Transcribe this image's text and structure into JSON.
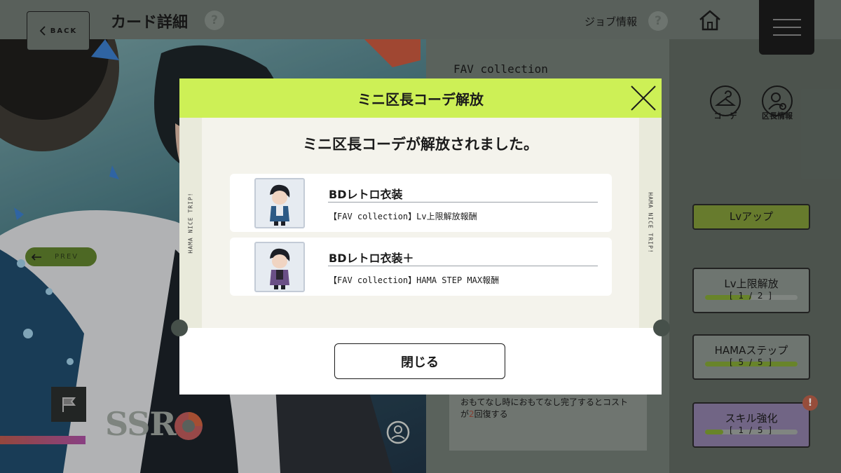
{
  "header": {
    "back_label": "BACK",
    "page_title": "カード詳細",
    "help_glyph": "?",
    "job_info_label": "ジョブ情報",
    "home_icon": "home-icon",
    "menu_icon": "hamburger-icon"
  },
  "card": {
    "collection_title": "FAV collection",
    "rarity": "SSR",
    "prev_label": "PREV",
    "nav_icons": [
      {
        "label": "コーデ",
        "icon": "hanger-icon"
      },
      {
        "label": "区長情報",
        "icon": "user-search-icon"
      }
    ],
    "lvup_label": "Lvアップ",
    "stats": [
      {
        "label": "Lv上限解放",
        "count": "[ 1 / 2 ]",
        "progress": 0.5
      },
      {
        "label": "HAMAステップ",
        "count": "[ 5 / 5 ]",
        "progress": 1.0
      },
      {
        "label": "スキル強化",
        "count": "[ 1 / 5 ]",
        "progress": 0.2
      }
    ],
    "alert_glyph": "!",
    "skill_desc_pre": "おもてなし時におもてなし完了するとコストが",
    "skill_desc_num": "2",
    "skill_desc_post": "回復する",
    "colors": {
      "accent_green": "#cdf056",
      "lvup_green": "#7e9638",
      "skill_purple": "#8a7ca3"
    }
  },
  "modal": {
    "title": "ミニ区長コーデ解放",
    "message": "ミニ区長コーデが解放されました。",
    "side_text": "HAMA NICE TRIP!",
    "rewards": [
      {
        "name": "BDレトロ衣装",
        "source": "【FAV collection】Lv上限解放報酬"
      },
      {
        "name": "BDレトロ衣装＋",
        "source": "【FAV collection】HAMA STEP MAX報酬"
      }
    ],
    "close_label": "閉じる"
  }
}
